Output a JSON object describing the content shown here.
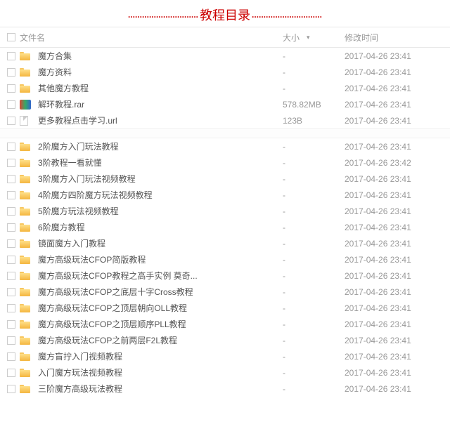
{
  "title": "教程目录",
  "columns": {
    "name": "文件名",
    "size": "大小",
    "date": "修改时间"
  },
  "group1": [
    {
      "icon": "folder",
      "name": "魔方合集",
      "size": "-",
      "date": "2017-04-26 23:41"
    },
    {
      "icon": "folder",
      "name": "魔方资料",
      "size": "-",
      "date": "2017-04-26 23:41"
    },
    {
      "icon": "folder",
      "name": "其他魔方教程",
      "size": "-",
      "date": "2017-04-26 23:41"
    },
    {
      "icon": "rar",
      "name": "解环教程.rar",
      "size": "578.82MB",
      "date": "2017-04-26 23:41"
    },
    {
      "icon": "url",
      "name": "更多教程点击学习.url",
      "size": "123B",
      "date": "2017-04-26 23:41"
    }
  ],
  "group2": [
    {
      "icon": "folder",
      "name": "2阶魔方入门玩法教程",
      "size": "-",
      "date": "2017-04-26 23:41"
    },
    {
      "icon": "folder",
      "name": "3阶教程一看就懂",
      "size": "-",
      "date": "2017-04-26 23:42"
    },
    {
      "icon": "folder",
      "name": "3阶魔方入门玩法视频教程",
      "size": "-",
      "date": "2017-04-26 23:41"
    },
    {
      "icon": "folder",
      "name": "4阶魔方四阶魔方玩法视频教程",
      "size": "-",
      "date": "2017-04-26 23:41"
    },
    {
      "icon": "folder",
      "name": "5阶魔方玩法视频教程",
      "size": "-",
      "date": "2017-04-26 23:41"
    },
    {
      "icon": "folder",
      "name": "6阶魔方教程",
      "size": "-",
      "date": "2017-04-26 23:41"
    },
    {
      "icon": "folder",
      "name": "镜面魔方入门教程",
      "size": "-",
      "date": "2017-04-26 23:41"
    },
    {
      "icon": "folder",
      "name": "魔方高级玩法CFOP简版教程",
      "size": "-",
      "date": "2017-04-26 23:41"
    },
    {
      "icon": "folder",
      "name": "魔方高级玩法CFOP教程之高手实例 莫奇...",
      "size": "-",
      "date": "2017-04-26 23:41"
    },
    {
      "icon": "folder",
      "name": "魔方高级玩法CFOP之底层十字Cross教程",
      "size": "-",
      "date": "2017-04-26 23:41"
    },
    {
      "icon": "folder",
      "name": "魔方高级玩法CFOP之顶层朝向OLL教程",
      "size": "-",
      "date": "2017-04-26 23:41"
    },
    {
      "icon": "folder",
      "name": "魔方高级玩法CFOP之顶层顺序PLL教程",
      "size": "-",
      "date": "2017-04-26 23:41"
    },
    {
      "icon": "folder",
      "name": "魔方高级玩法CFOP之前两层F2L教程",
      "size": "-",
      "date": "2017-04-26 23:41"
    },
    {
      "icon": "folder",
      "name": "魔方盲拧入门视频教程",
      "size": "-",
      "date": "2017-04-26 23:41"
    },
    {
      "icon": "folder",
      "name": "入门魔方玩法视频教程",
      "size": "-",
      "date": "2017-04-26 23:41"
    },
    {
      "icon": "folder",
      "name": "三阶魔方高级玩法教程",
      "size": "-",
      "date": "2017-04-26 23:41"
    }
  ]
}
